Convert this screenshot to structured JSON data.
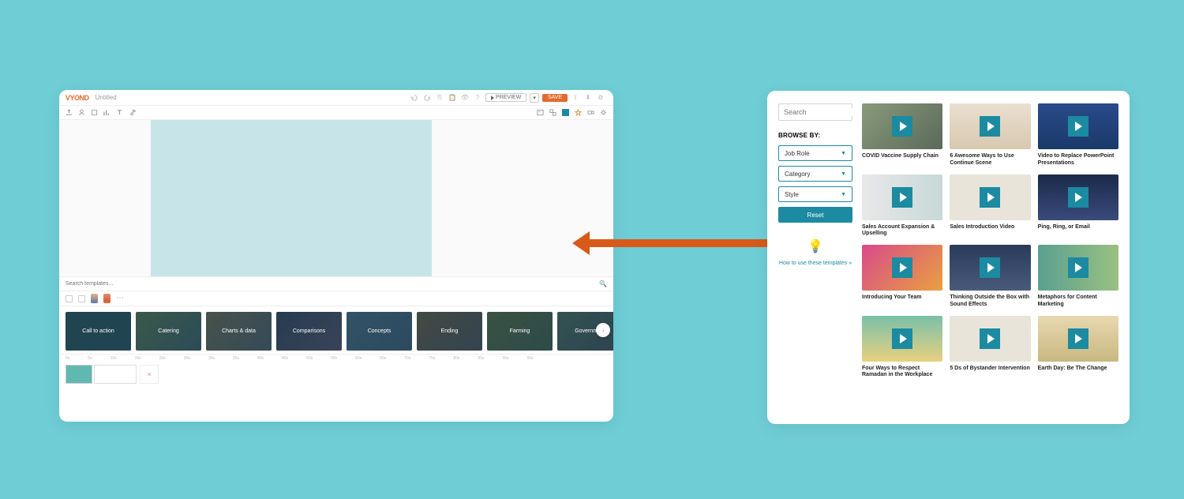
{
  "editor": {
    "logo": "VYOND",
    "title": "Untitled",
    "preview": "PREVIEW",
    "save": "SAVE",
    "searchTemplates": "Search templates...",
    "templates": [
      {
        "label": "Call to action"
      },
      {
        "label": "Catering"
      },
      {
        "label": "Charts & data"
      },
      {
        "label": "Comparisons"
      },
      {
        "label": "Concepts"
      },
      {
        "label": "Ending"
      },
      {
        "label": "Farming"
      },
      {
        "label": "Government"
      }
    ]
  },
  "library": {
    "search": "Search",
    "browseBy": "BROWSE BY:",
    "filters": [
      {
        "label": "Job Role"
      },
      {
        "label": "Category"
      },
      {
        "label": "Style"
      }
    ],
    "reset": "Reset",
    "howto": "How to use these templates »",
    "cards": [
      {
        "title": "COVID Vaccine Supply Chain"
      },
      {
        "title": "6 Awesome Ways to Use Continue Scene"
      },
      {
        "title": "Video to Replace PowerPoint Presentations"
      },
      {
        "title": "Sales Account Expansion & Upselling"
      },
      {
        "title": "Sales Introduction Video"
      },
      {
        "title": "Ping, Ring, or Email"
      },
      {
        "title": "Introducing Your Team"
      },
      {
        "title": "Thinking Outside the Box with Sound Effects"
      },
      {
        "title": "Metaphors for Content Marketing"
      },
      {
        "title": "Four Ways to Respect Ramadan in the Workplace"
      },
      {
        "title": "5 Ds of Bystander Intervention"
      },
      {
        "title": "Earth Day: Be The Change"
      }
    ]
  }
}
